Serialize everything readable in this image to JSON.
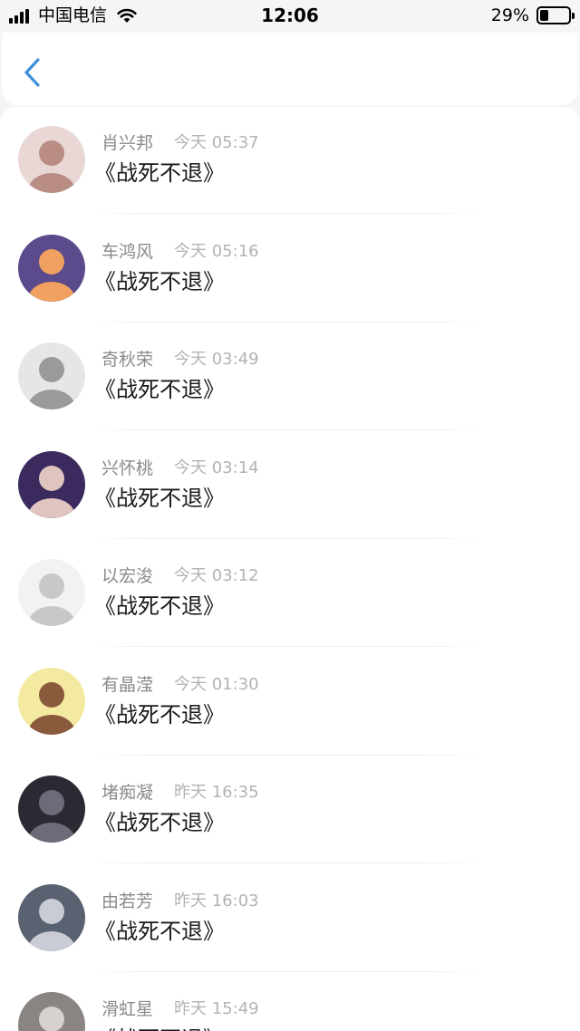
{
  "status_bar": {
    "carrier": "中国电信",
    "time": "12:06",
    "battery_percent": "29%",
    "battery_level": 0.29
  },
  "nav": {
    "back_icon": "chevron-left-icon"
  },
  "items": [
    {
      "name": "肖兴邦",
      "time": "今天 05:37",
      "message": "《战死不退》",
      "avatar": {
        "bg": "#e8d7d4",
        "fg": "#b98d83"
      }
    },
    {
      "name": "车鸿风",
      "time": "今天 05:16",
      "message": "《战死不退》",
      "avatar": {
        "bg": "#5b4a8c",
        "fg": "#f0a060"
      }
    },
    {
      "name": "奇秋荣",
      "time": "今天 03:49",
      "message": "《战死不退》",
      "avatar": {
        "bg": "#e6e6e6",
        "fg": "#9a9a9a"
      }
    },
    {
      "name": "兴怀桃",
      "time": "今天 03:14",
      "message": "《战死不退》",
      "avatar": {
        "bg": "#3b2a5e",
        "fg": "#e0c4c0"
      }
    },
    {
      "name": "以宏浚",
      "time": "今天 03:12",
      "message": "《战死不退》",
      "avatar": {
        "bg": "#f2f2f2",
        "fg": "#c8c8c8"
      }
    },
    {
      "name": "有晶滢",
      "time": "今天 01:30",
      "message": "《战死不退》",
      "avatar": {
        "bg": "#f3e9a0",
        "fg": "#8a5a3c"
      }
    },
    {
      "name": "堵痴凝",
      "time": "昨天 16:35",
      "message": "《战死不退》",
      "avatar": {
        "bg": "#2a2a33",
        "fg": "#6e6a7a"
      }
    },
    {
      "name": "由若芳",
      "time": "昨天 16:03",
      "message": "《战死不退》",
      "avatar": {
        "bg": "#5a6170",
        "fg": "#c9ccd4"
      }
    },
    {
      "name": "滑虹星",
      "time": "昨天 15:49",
      "message": "《战死不退》",
      "avatar": {
        "bg": "#8a8482",
        "fg": "#d8d2cf"
      }
    }
  ],
  "colors": {
    "accent": "#3d8fe0",
    "name_text": "#8a8a8a",
    "time_text": "#b3b3b3"
  }
}
